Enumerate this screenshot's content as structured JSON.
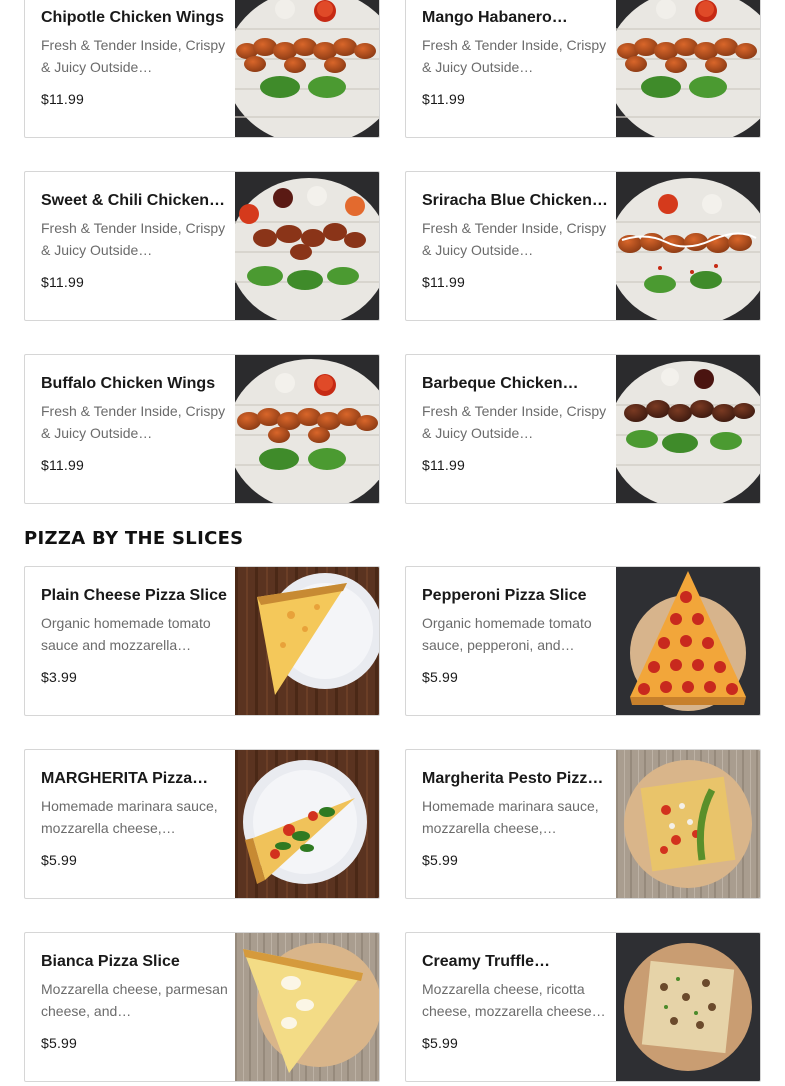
{
  "wings": [
    {
      "title": "Chipotle Chicken Wings",
      "desc": "Fresh & Tender Inside, Crispy & Juicy Outside…",
      "price": "$11.99"
    },
    {
      "title": "Mango Habanero…",
      "desc": "Fresh & Tender Inside, Crispy & Juicy Outside…",
      "price": "$11.99"
    },
    {
      "title": "Sweet & Chili Chicken…",
      "desc": "Fresh & Tender Inside, Crispy & Juicy Outside…",
      "price": "$11.99"
    },
    {
      "title": "Sriracha Blue Chicken…",
      "desc": "Fresh & Tender Inside, Crispy & Juicy Outside…",
      "price": "$11.99"
    },
    {
      "title": "Buffalo Chicken Wings",
      "desc": "Fresh & Tender Inside, Crispy & Juicy Outside…",
      "price": "$11.99"
    },
    {
      "title": "Barbeque Chicken…",
      "desc": "Fresh & Tender Inside, Crispy & Juicy Outside…",
      "price": "$11.99"
    }
  ],
  "pizza_section": {
    "title": "PIZZA BY THE SLICES",
    "items": [
      {
        "title": "Plain Cheese Pizza Slice",
        "desc": "Organic homemade tomato sauce and mozzarella…",
        "price": "$3.99"
      },
      {
        "title": "Pepperoni Pizza Slice",
        "desc": "Organic homemade tomato sauce, pepperoni, and…",
        "price": "$5.99"
      },
      {
        "title": "MARGHERITA Pizza…",
        "desc": "Homemade marinara sauce, mozzarella cheese,…",
        "price": "$5.99"
      },
      {
        "title": "Margherita Pesto Pizz…",
        "desc": "Homemade marinara sauce, mozzarella cheese,…",
        "price": "$5.99"
      },
      {
        "title": "Bianca Pizza Slice",
        "desc": "Mozzarella cheese, parmesan cheese, and…",
        "price": "$5.99"
      },
      {
        "title": "Creamy Truffle…",
        "desc": "Mozzarella cheese, ricotta cheese, mozzarella cheese…",
        "price": "$5.99"
      }
    ]
  },
  "colors": {
    "accent_text": "#191919",
    "muted_text": "#6b6b6b",
    "border": "#d6d6d6"
  }
}
